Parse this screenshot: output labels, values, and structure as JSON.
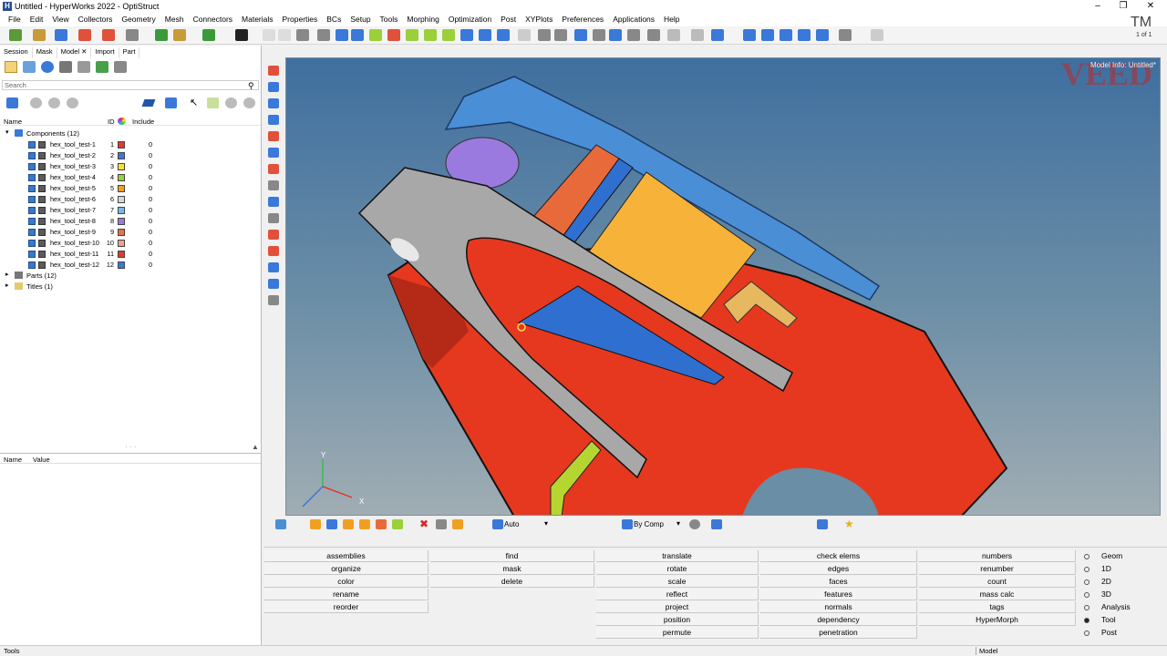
{
  "title": "Untitled - HyperWorks 2022 - OptiStruct",
  "window": {
    "minimize": "–",
    "restore": "❐",
    "close": "✕"
  },
  "menu": [
    "File",
    "Edit",
    "View",
    "Collectors",
    "Geometry",
    "Mesh",
    "Connectors",
    "Materials",
    "Properties",
    "BCs",
    "Setup",
    "Tools",
    "Morphing",
    "Optimization",
    "Post",
    "XYPlots",
    "Preferences",
    "Applications",
    "Help"
  ],
  "tabs": [
    "Session",
    "Mask",
    "Model ✕",
    "Import",
    "Part"
  ],
  "search_placeholder": "Search",
  "columns": {
    "name": "Name",
    "id": "ID",
    "include": "Include"
  },
  "tree": {
    "components_label": "Components (12)",
    "components": [
      {
        "name": "hex_tool_test-1",
        "id": "1",
        "color": "#e03a2a",
        "include": "0"
      },
      {
        "name": "hex_tool_test-2",
        "id": "2",
        "color": "#3a78d9",
        "include": "0"
      },
      {
        "name": "hex_tool_test-3",
        "id": "3",
        "color": "#f3e23a",
        "include": "0"
      },
      {
        "name": "hex_tool_test-4",
        "id": "4",
        "color": "#9ad03a",
        "include": "0"
      },
      {
        "name": "hex_tool_test-5",
        "id": "5",
        "color": "#f0a020",
        "include": "0"
      },
      {
        "name": "hex_tool_test-6",
        "id": "6",
        "color": "#d8d8d8",
        "include": "0"
      },
      {
        "name": "hex_tool_test-7",
        "id": "7",
        "color": "#7ab8e8",
        "include": "0"
      },
      {
        "name": "hex_tool_test-8",
        "id": "8",
        "color": "#9a7ae0",
        "include": "0"
      },
      {
        "name": "hex_tool_test-9",
        "id": "9",
        "color": "#e8704a",
        "include": "0"
      },
      {
        "name": "hex_tool_test-10",
        "id": "10",
        "color": "#f0a090",
        "include": "0"
      },
      {
        "name": "hex_tool_test-11",
        "id": "11",
        "color": "#e03a2a",
        "include": "0"
      },
      {
        "name": "hex_tool_test-12",
        "id": "12",
        "color": "#3a78d9",
        "include": "0"
      }
    ],
    "parts_label": "Parts (12)",
    "titles_label": "Titles (1)"
  },
  "props": {
    "name": "Name",
    "value": "Value"
  },
  "viewport": {
    "model_info": "Model Info: Untitled*",
    "watermark": "VEED",
    "tm": "TM",
    "page": "1 of 1"
  },
  "vp_toolbar": {
    "auto": "Auto",
    "by_comp": "By Comp"
  },
  "panel": {
    "col1": [
      "assemblies",
      "organize",
      "color",
      "rename",
      "reorder"
    ],
    "col2": [
      "find",
      "mask",
      "delete"
    ],
    "col3": [
      "translate",
      "rotate",
      "scale",
      "reflect",
      "project",
      "position",
      "permute"
    ],
    "col4": [
      "check elems",
      "edges",
      "faces",
      "features",
      "normals",
      "dependency",
      "penetration"
    ],
    "col5": [
      "numbers",
      "renumber",
      "count",
      "mass calc",
      "tags",
      "HyperMorph"
    ],
    "radios": [
      "Geom",
      "1D",
      "2D",
      "3D",
      "Analysis",
      "Tool",
      "Post"
    ],
    "radio_selected": "Tool"
  },
  "status": {
    "left": "Tools",
    "model": "Model"
  }
}
